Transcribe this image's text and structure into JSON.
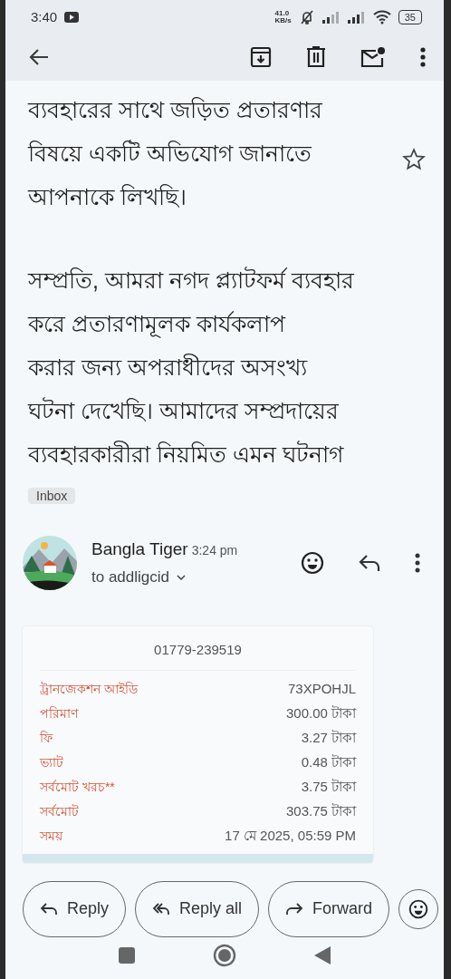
{
  "status_bar": {
    "time": "3:40",
    "net_speed": "41.0",
    "net_unit": "KB/s",
    "battery": "35"
  },
  "message": {
    "paragraphs": [
      {
        "lines": [
          "ব্যবহারের সাথে জড়িত প্রতারণার",
          "বিষয়ে একটি অভিযোগ জানাতে",
          "আপনাকে লিখছি।"
        ]
      },
      {
        "lines": [
          "সম্প্রতি, আমরা নগদ প্ল্যাটফর্ম ব্যবহার",
          "করে প্রতারণামূলক কার্যকলাপ",
          "করার জন্য অপরাধীদের অসংখ্য",
          "ঘটনা দেখেছি। আমাদের সম্প্রদায়ের",
          "ব্যবহারকারীরা নিয়মিত এমন ঘটনাগ"
        ]
      }
    ],
    "starred": false,
    "label": "Inbox"
  },
  "sender": {
    "name": "Bangla Tiger",
    "time": "3:24 pm",
    "to": "to addligcid"
  },
  "receipt": {
    "phone": "01779-239519",
    "rows": [
      {
        "label": "ট্রানজেকশন আইডি",
        "value": "73XPOHJL"
      },
      {
        "label": "পরিমাণ",
        "value": "300.00 টাকা"
      },
      {
        "label": "ফি",
        "value": "3.27 টাকা"
      },
      {
        "label": "ভ্যাট",
        "value": "0.48 টাকা"
      },
      {
        "label": "সর্বমোট খরচ**",
        "value": "3.75 টাকা"
      },
      {
        "label": "সর্বমোট",
        "value": "303.75 টাকা"
      },
      {
        "label": "সময়",
        "value": "17 মে 2025, 05:59 PM"
      }
    ]
  },
  "actions": [
    {
      "kind": "reply",
      "label": "Reply"
    },
    {
      "kind": "reply_all",
      "label": "Reply all"
    },
    {
      "kind": "forward",
      "label": "Forward"
    }
  ]
}
